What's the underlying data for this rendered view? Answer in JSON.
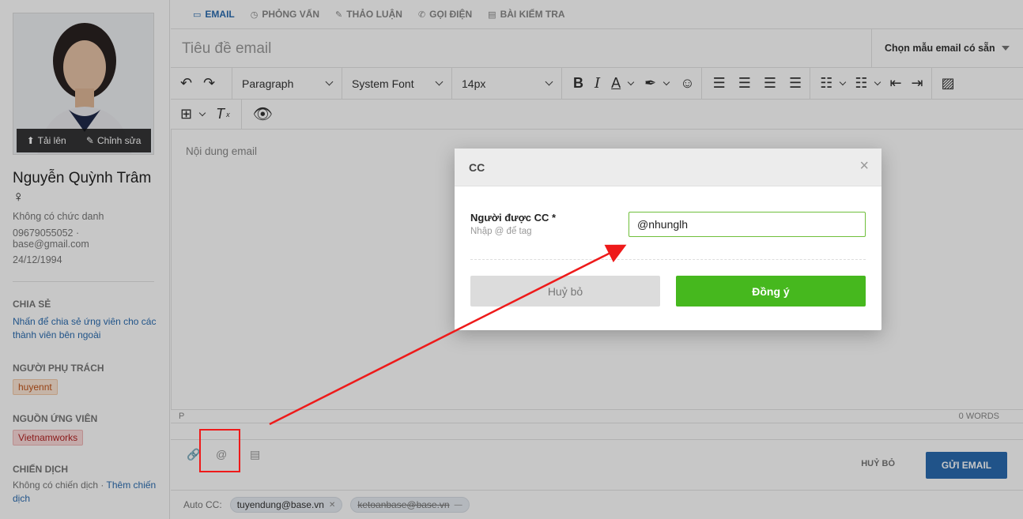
{
  "profile": {
    "upload_label": "Tải lên",
    "edit_label": "Chỉnh sửa",
    "name": "Nguyễn Quỳnh Trâm ♀",
    "job_title": "Không có chức danh",
    "phone": "09679055052 ·",
    "email": "base@gmail.com",
    "birthday": "24/12/1994"
  },
  "share": {
    "title": "CHIA SẺ",
    "link": "Nhấn để chia sẻ ứng viên cho các thành viên bên ngoài"
  },
  "owner": {
    "title": "NGƯỜI PHỤ TRÁCH",
    "tag": "huyennt"
  },
  "source": {
    "title": "NGUỒN ỨNG VIÊN",
    "tag": "Vietnamworks"
  },
  "campaign": {
    "title": "CHIẾN DỊCH",
    "text": "Không có chiến dịch ·",
    "link": "Thêm chiến dịch"
  },
  "tabs": [
    {
      "label": "EMAIL",
      "icon": "chat-icon"
    },
    {
      "label": "PHỎNG VẤN",
      "icon": "clock-icon"
    },
    {
      "label": "THẢO LUẬN",
      "icon": "pencil-icon"
    },
    {
      "label": "GỌI ĐIỆN",
      "icon": "phone-icon"
    },
    {
      "label": "BÀI KIỂM TRA",
      "icon": "document-icon"
    }
  ],
  "email": {
    "subject_placeholder": "Tiêu đề email",
    "template_select": "Chọn mẫu email có sẵn",
    "block_format": "Paragraph",
    "font_family": "System Font",
    "font_size": "14px",
    "body_placeholder": "Nội dung email",
    "status_path": "P",
    "word_count": "0 WORDS",
    "cancel_label": "HUỶ BỎ",
    "send_label": "GỬI EMAIL"
  },
  "autocc": {
    "label": "Auto CC:",
    "chips": [
      "tuyendung@base.vn",
      "ketoanbase@base.vn"
    ]
  },
  "modal": {
    "title": "CC",
    "field_label": "Người được CC *",
    "field_hint": "Nhập @ để tag",
    "field_value": "@nhunglh",
    "cancel_label": "Huỷ bỏ",
    "confirm_label": "Đồng ý"
  },
  "colors": {
    "accent_blue": "#2a6bb0",
    "confirm_green": "#46b81e",
    "annotation_red": "#ee1a1a"
  }
}
